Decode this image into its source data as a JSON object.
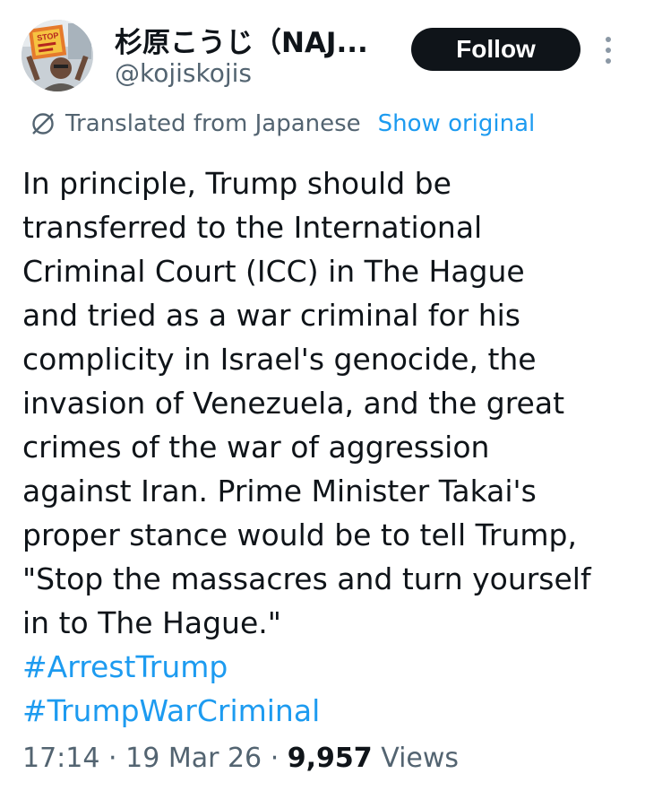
{
  "author": {
    "display_name": "杉原こうじ（NAJ...",
    "handle": "@kojiskojis",
    "avatar_sign_text": "STOP"
  },
  "actions": {
    "follow_label": "Follow",
    "more_icon": "more-vertical-icon"
  },
  "translation": {
    "icon": "translate-globe-icon",
    "label": "Translated from Japanese",
    "show_original_label": "Show original"
  },
  "tweet": {
    "lines": [
      "In principle, Trump should be",
      "transferred to the International",
      "Criminal Court (ICC) in The Hague",
      "and tried as a war criminal for his",
      "complicity in Israel's genocide, the",
      "invasion of Venezuela, and the great",
      "crimes of the war of aggression",
      "against Iran. Prime Minister Takai's",
      "proper stance would be to tell Trump,",
      "\"Stop the massacres and turn yourself",
      "in to The Hague.\""
    ],
    "hashtags": [
      "#ArrestTrump",
      "#TrumpWarCriminal"
    ]
  },
  "meta": {
    "time": "17:14",
    "separator": "·",
    "date": "19 Mar 26",
    "views_count": "9,957",
    "views_label": "Views"
  },
  "colors": {
    "accent": "#1d9bf0",
    "secondary_text": "#536471",
    "primary_text": "#0f1419",
    "button_bg": "#0f1419"
  }
}
